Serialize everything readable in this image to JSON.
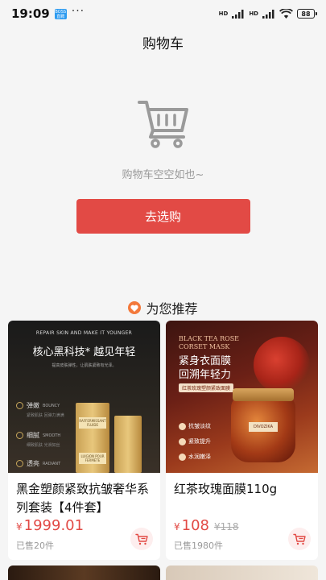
{
  "status_bar": {
    "time": "19:09",
    "badge": "BOSS 直聘",
    "dots": "···",
    "network": "HD",
    "battery": "88"
  },
  "header": {
    "title": "购物车"
  },
  "empty_state": {
    "icon": "cart-icon",
    "message": "购物车空空如也~",
    "button_label": "去选购"
  },
  "recommend": {
    "icon": "heart-icon",
    "title": "为您推荐"
  },
  "products": [
    {
      "name": "黑金塑颜紧致抗皱奢华系列套装【4件套】",
      "currency": "¥",
      "price": "1999.01",
      "old_price": "",
      "sold": "已售20件",
      "image": {
        "tagline_en": "REPAIR SKIN AND MAKE IT YOUNGER",
        "headline": "核心黑科技* 越见年轻",
        "subline": "提高皮肤弹性，让肌肤紧致有光泽。",
        "features": [
          {
            "cn": "弹嫩",
            "en": "BOUNCY",
            "sub": "紧致肌肤 回弹力满满"
          },
          {
            "cn": "细腻",
            "en": "SMOOTH",
            "sub": "细致肌肤 光滑如丝"
          },
          {
            "cn": "透亮",
            "en": "RADIANT",
            "sub": ""
          }
        ],
        "bottle_text": "RAFFERMISSANT FLUIDE",
        "bottle_text2": "LUIGION POUR FERMETE"
      }
    },
    {
      "name": "红茶玫瑰面膜110g",
      "currency": "¥",
      "price": "108",
      "old_price": "¥118",
      "sold": "已售1980件",
      "image": {
        "tagline_en": "BLACK TEA ROSE CORSET MASK",
        "headline_1": "紧身衣面膜",
        "headline_2": "回溯年轻力",
        "badge": "红茶玫瑰塑颜紧致面膜",
        "features": [
          "抗皱淡纹",
          "紧致提升",
          "水润嫩泽"
        ],
        "jar_label": "DIVOZIKA"
      }
    }
  ],
  "colors": {
    "accent": "#e24a45",
    "heart": "#f3793b",
    "background": "#f5f5f5"
  }
}
